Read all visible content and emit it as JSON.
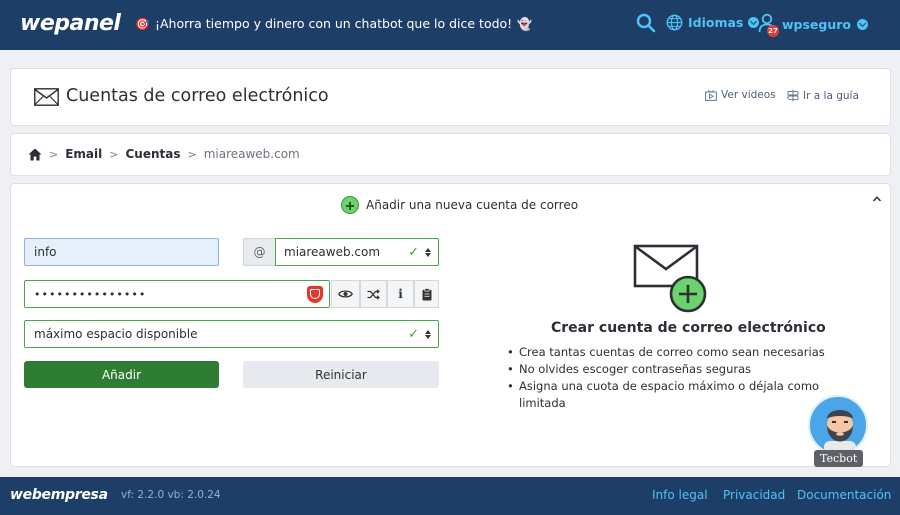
{
  "topbar": {
    "logo": "wepanel",
    "promo": "¡Ahorra tiempo y dinero con un chatbot que lo dice todo!",
    "languages": "Idiomas",
    "username": "wpseguro",
    "notifications": "27"
  },
  "header": {
    "title": "Cuentas de correo electrónico",
    "videos": "Ver videos",
    "guide": "Ir a la guía"
  },
  "breadcrumb": {
    "email": "Email",
    "accounts": "Cuentas",
    "domain": "miareaweb.com"
  },
  "form": {
    "heading": "Añadir una nueva cuenta de correo",
    "user_value": "info",
    "at": "@",
    "domain_value": "miareaweb.com",
    "password_value": "•••••••••••••••",
    "quota_value": "máximo espacio disponible",
    "add_label": "Añadir",
    "reset_label": "Reiniciar"
  },
  "info": {
    "title": "Crear cuenta de correo electrónico",
    "items": [
      "Crea tantas cuentas de correo como sean necesarias",
      "No olvides escoger contraseñas seguras",
      "Asigna una cuota de espacio máximo o déjala como limitada"
    ]
  },
  "chatbot": {
    "label": "Tecbot"
  },
  "footer": {
    "logo": "webempresa",
    "version": "vf: 2.2.0 vb: 2.0.24",
    "links": [
      "Info legal",
      "Privacidad",
      "Documentación"
    ]
  },
  "colors": {
    "navy": "#1d3e66",
    "accent": "#4fc3f7",
    "success": "#2e7d32"
  }
}
